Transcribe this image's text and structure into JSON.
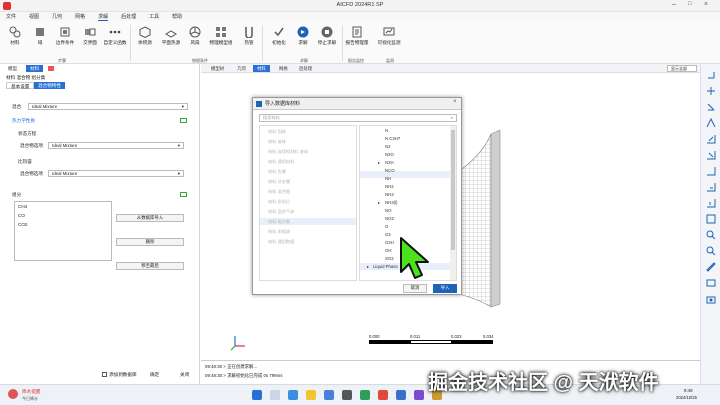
{
  "window": {
    "title": "AICFD 2024R1 SP"
  },
  "menu": [
    "文件",
    "视图",
    "几何",
    "网格",
    "求解",
    "后处理",
    "工具",
    "帮助"
  ],
  "ribbon": {
    "buttons": [
      "材料",
      "域",
      "边界条件",
      "交界面",
      "自定义函数",
      "体积源",
      "平面热源",
      "风扇",
      "物理模型组",
      "热管",
      "初始化",
      "求解",
      "停止求解",
      "报告物理量",
      "可视化监测"
    ],
    "groups": [
      "步骤",
      "物理条件",
      "求解",
      "报告监控",
      "监测"
    ]
  },
  "left_panel": {
    "tabs": [
      "模型",
      "材料"
    ],
    "sub_tabs": [
      "基本设置",
      "混合物特性"
    ],
    "breadcrumb": "材料 混合物 组分集",
    "mix_label": "混合",
    "mix_value": "Ideal Mixture",
    "thermo_header": "热力学性质",
    "state_eq_label": "状态方程",
    "mix_rule_label": "混合物选项",
    "mix_rule_value": "Ideal Mixture",
    "transport_label": "比热容",
    "transport_rule_label": "混合物选项",
    "transport_rule_value": "Ideal Mixture",
    "species_header": "组分",
    "species": [
      "CH4",
      "CO",
      "CO2"
    ],
    "btn_import": "从数据库导入",
    "btn_delete": "删除",
    "btn_move": "移至最后",
    "checkbox_label": "添加到数据库",
    "ok": "确定",
    "close": "关闭"
  },
  "viewport": {
    "tabs": [
      "模型树",
      "几何",
      "材料",
      "网格",
      "后处理"
    ],
    "active_tab": "材料",
    "view_select": "显示全部",
    "scale_labels": [
      "0.000",
      "0.011",
      "0.023",
      "0.034"
    ]
  },
  "dialog": {
    "title": "导入数据库材料",
    "search_placeholder": "搜索材料",
    "categories": [
      "材料 固体",
      "材料 液体",
      "材料 连续相材料 液体",
      "材料 通用材料",
      "材料 金属",
      "材料 非金属",
      "材料 混合物",
      "材料 多组分",
      "材料 混合气体",
      "材料 组分集",
      "材料 多相流",
      "材料 通用数据"
    ],
    "species": [
      "N",
      "N C3H7",
      "N2",
      "N2O",
      "N2H",
      "NCO",
      "NH",
      "NH2",
      "NH3",
      "NH3(l)",
      "NO",
      "NO2",
      "O",
      "O2",
      "O2H",
      "OH",
      "SO2",
      "Liquid Phase"
    ],
    "selected_category": 9,
    "highlighted_species": [
      2,
      13
    ],
    "cancel": "取消",
    "ok": "导入"
  },
  "messages": [
    "09:48:30 > 正在创建求解...",
    "09:48:30 > 求解初始化已完成 0s 799ms"
  ],
  "taskbar": {
    "weather": "降水提醒",
    "weather_sub": "今日降水",
    "time": "9:49",
    "date": "2024/10/25"
  },
  "watermark": "掘金技术社区 @ 天洑软件",
  "colors": {
    "accent": "#1e63b8",
    "cursor": "#4be21a",
    "active_tab": "#2a6fd6"
  }
}
